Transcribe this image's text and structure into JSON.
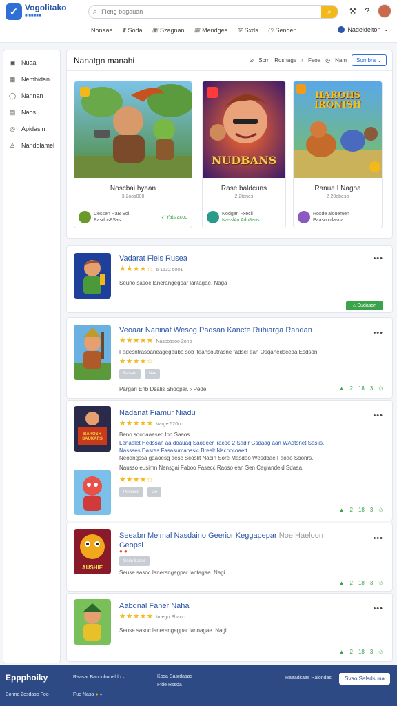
{
  "header": {
    "logo_title": "Vogolitako",
    "logo_sub": "■ ■■■■■",
    "search_placeholder": "Fleng bqgauan",
    "nav": [
      "Nonaae",
      "Soda",
      "Szagnan",
      "Mendges",
      "Sxds",
      "Senden"
    ],
    "lang": "Nadeldelton",
    "colors": {
      "brand": "#2c57a8",
      "accent": "#f2b81c",
      "green": "#3ba34a"
    }
  },
  "sidebar": {
    "items": [
      {
        "label": "Nuaa",
        "icon": "square-icon"
      },
      {
        "label": "Nembidan",
        "icon": "grid-icon"
      },
      {
        "label": "Nannan",
        "icon": "chat-icon"
      },
      {
        "label": "Naos",
        "icon": "document-icon"
      },
      {
        "label": "Apidasin",
        "icon": "circle-icon"
      },
      {
        "label": "Nandolamel",
        "icon": "person-icon"
      }
    ]
  },
  "featured": {
    "title": "Nanatgn manahi",
    "tools": {
      "t1": "Scm",
      "t2": "Rosnage",
      "t3": "Faoa",
      "t4": "Nam",
      "button": "Sombra"
    },
    "cards": [
      {
        "name": "Noscbai hyaan",
        "by": "3 2oos000",
        "dev": "Cessen RaB Sol",
        "dev_sub": "Pasdos8Sas",
        "tag": "Yats acoo"
      },
      {
        "name": "Rase baldcuns",
        "by": "2 2tanes",
        "dev": "Nodgan Fxecil",
        "dev_sub": "Nassl4n Adn8ans",
        "tag": ""
      },
      {
        "name": "Ranua I Nagoa",
        "by": "2 20abeso",
        "dev": "Rosde alouemen",
        "dev_sub": "Paaso cdasoa",
        "tag": ""
      }
    ],
    "art_texts": [
      "NUDBANS",
      "HAROHS IRONISH"
    ]
  },
  "list": [
    {
      "title": "Vadarat Fiels Rusea",
      "rating": "★★★★☆",
      "rating_text": "6 1532 5001",
      "desc": "Seuno sasoc lanerangegpar lantagae. Naga",
      "button": "Sudason"
    },
    {
      "title": "Veoaar Naninat Wesog Padsan Kancte Ruhiarga Randan",
      "rating": "★★★★★",
      "rating_text": "Nascossoo 2ono",
      "desc": "Fadesntrasoaneagegeuba sob iteansoutrasne fadsel ean Osqanedsceda Esdson.",
      "rating2": "★★★★☆",
      "tags": [
        "Batsan",
        "Nas"
      ],
      "link": "Pargari Enb Dsalis Shoopar.",
      "link2": "Pede",
      "stats": [
        "2",
        "18",
        "3"
      ]
    },
    {
      "title": "Nadanat Fiamur Niadu",
      "rating": "★★★★★",
      "rating_text": "Varge 520oo",
      "desc": "Beno soodaaesed lbo Saaos",
      "desc_lines": [
        "Lenaelet Hedssan aa doauaq Saodeer Iracoo 2 Sadir Gsdaag aan WAdtsnet Sasiis.",
        "Nassses Dasres Fasasumanssic Brealt Nacoccoaett.",
        "Neodngssa gaaoesg aesc Scoslit Nacin Sore Masdoo Wesdbae Faoao Soonrs.",
        "Nausso eusimn Nensgai Faboo Fasecc Raoso ean Sen Cegiandeld Sdaaa."
      ],
      "rating2": "★★★★☆",
      "tags": [
        "Posdoss",
        "Oo"
      ],
      "stats": [
        "2",
        "18",
        "3"
      ],
      "art_text": "BAROSH SAUKARS"
    },
    {
      "title": "Seeabn Meimal Nasdaino Geerior Keggapepar",
      "title2": "Noe Haeloon",
      "sub": "Geopsi",
      "rating_text": "Sedo Sadss",
      "desc": "Seuse sasoc lanerangegpar lantagae. Nagi",
      "stats": [
        "2",
        "18",
        "3"
      ],
      "art_text": "AUSHIE"
    },
    {
      "title": "Aabdnal Faner Naha",
      "rating": "★★★★★",
      "rating_text": "Vuego Shacc",
      "desc": "Seuse sasoc lanerangegpar lanoagae. Nagi",
      "stats": [
        "2",
        "18",
        "3"
      ]
    }
  ],
  "footer": {
    "brand": "Eppphoiky",
    "row1": "Bonna 2osdaso Foo",
    "col1_a": "Raasar Banoubnoeldo",
    "col1_b": "Fuo Nasa",
    "col2_a": "Kosa Sasrdasas",
    "col2_b": "Ffde Rssda",
    "col3": "Raaadsaas Ralondas",
    "button": "Svao Salsdsuna"
  }
}
